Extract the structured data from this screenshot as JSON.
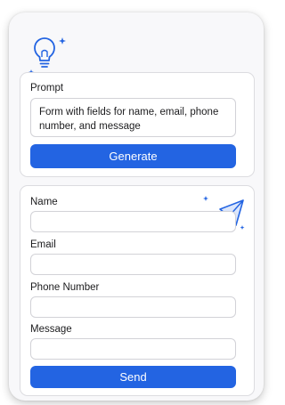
{
  "prompt": {
    "label": "Prompt",
    "value": "Form with fields for name, email, phone number, and message",
    "button_label": "Generate"
  },
  "form": {
    "fields": [
      {
        "label": "Name",
        "value": ""
      },
      {
        "label": "Email",
        "value": ""
      },
      {
        "label": "Phone Number",
        "value": ""
      },
      {
        "label": "Message",
        "value": ""
      }
    ],
    "submit_label": "Send"
  },
  "icons": {
    "header": "lightbulb-icon",
    "form_decoration": "paper-plane-icon"
  },
  "colors": {
    "accent": "#2364e2",
    "card_background": "#f8f8fa",
    "panel_border": "#dcdce0"
  }
}
